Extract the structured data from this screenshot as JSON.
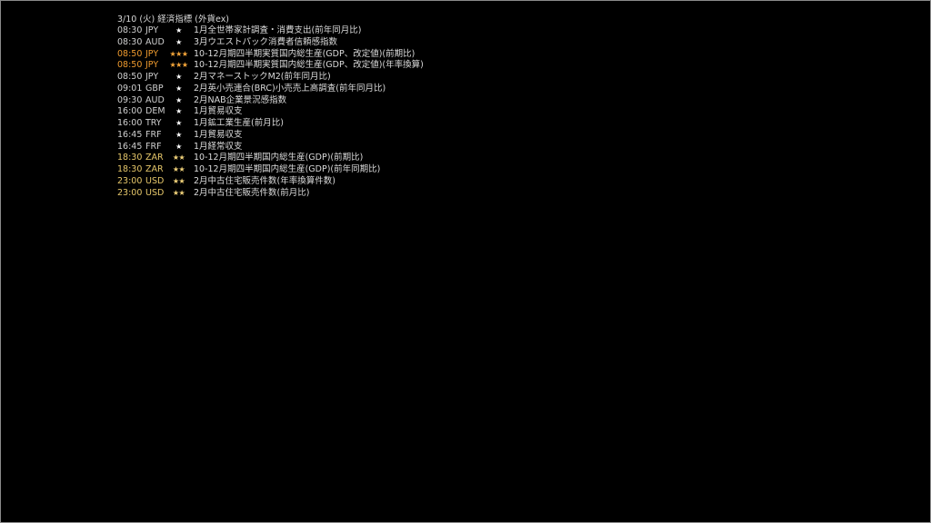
{
  "calendar": {
    "header": "3/10 (火) 経済指標 (外貨ex)",
    "colors": {
      "tier_1": "#cfcfcf",
      "tier_2": "#e6c76a",
      "tier_3": "#ee9a2e",
      "background": "#000000"
    },
    "events": [
      {
        "time": "08:30",
        "currency": "JPY",
        "stars": "★",
        "importance": 1,
        "title": "1月全世帯家計調査・消費支出(前年同月比)"
      },
      {
        "time": "08:30",
        "currency": "AUD",
        "stars": "★",
        "importance": 1,
        "title": "3月ウエストパック消費者信頼感指数"
      },
      {
        "time": "08:50",
        "currency": "JPY",
        "stars": "★★★",
        "importance": 3,
        "title": "10-12月期四半期実質国内総生産(GDP、改定値)(前期比)"
      },
      {
        "time": "08:50",
        "currency": "JPY",
        "stars": "★★★",
        "importance": 3,
        "title": "10-12月期四半期実質国内総生産(GDP、改定値)(年率換算)"
      },
      {
        "time": "08:50",
        "currency": "JPY",
        "stars": "★",
        "importance": 1,
        "title": "2月マネーストックM2(前年同月比)"
      },
      {
        "time": "09:01",
        "currency": "GBP",
        "stars": "★",
        "importance": 1,
        "title": "2月英小売連合(BRC)小売売上高調査(前年同月比)"
      },
      {
        "time": "09:30",
        "currency": "AUD",
        "stars": "★",
        "importance": 1,
        "title": "2月NAB企業景況感指数"
      },
      {
        "time": "16:00",
        "currency": "DEM",
        "stars": "★",
        "importance": 1,
        "title": "1月貿易収支"
      },
      {
        "time": "16:00",
        "currency": "TRY",
        "stars": "★",
        "importance": 1,
        "title": "1月鉱工業生産(前月比)"
      },
      {
        "time": "16:45",
        "currency": "FRF",
        "stars": "★",
        "importance": 1,
        "title": "1月貿易収支"
      },
      {
        "time": "16:45",
        "currency": "FRF",
        "stars": "★",
        "importance": 1,
        "title": "1月経常収支"
      },
      {
        "time": "18:30",
        "currency": "ZAR",
        "stars": "★★",
        "importance": 2,
        "title": "10-12月期四半期国内総生産(GDP)(前期比)"
      },
      {
        "time": "18:30",
        "currency": "ZAR",
        "stars": "★★",
        "importance": 2,
        "title": "10-12月期四半期国内総生産(GDP)(前年同期比)"
      },
      {
        "time": "23:00",
        "currency": "USD",
        "stars": "★★",
        "importance": 2,
        "title": "2月中古住宅販売件数(年率換算件数)"
      },
      {
        "time": "23:00",
        "currency": "USD",
        "stars": "★★",
        "importance": 2,
        "title": "2月中古住宅販売件数(前月比)"
      }
    ]
  }
}
